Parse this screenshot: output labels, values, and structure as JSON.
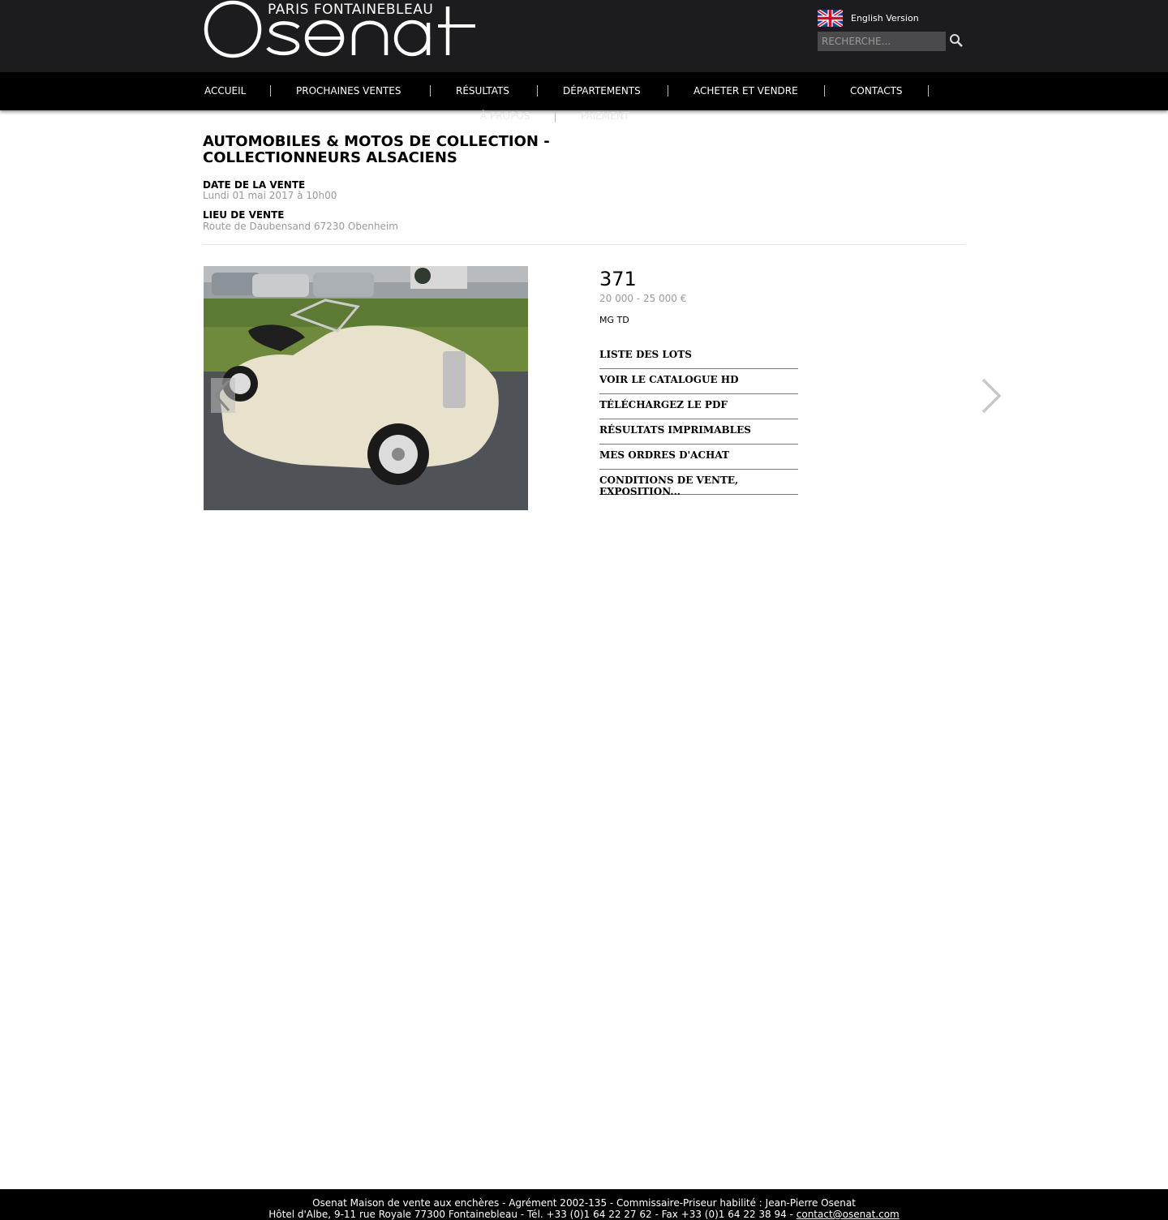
{
  "header": {
    "logo_tagline": "PARIS FONTAINEBLEAU",
    "logo_wordmark": "Osenat",
    "language_link": "English Version",
    "search_placeholder": "RECHERCHE...",
    "flag_icon": "uk-flag-icon",
    "search_icon": "magnifier-icon"
  },
  "nav": {
    "items": [
      "ACCUEIL",
      "PROCHAINES VENTES",
      "RÉSULTATS",
      "DÉPARTEMENTS",
      "ACHETER ET VENDRE",
      "CONTACTS"
    ],
    "row2": [
      "À PROPOS",
      "PAIEMENT"
    ]
  },
  "sale": {
    "title": "AUTOMOBILES & MOTOS DE COLLECTION - COLLECTIONNEURS ALSACIENS",
    "date_label": "DATE DE LA VENTE",
    "date_value": "Lundi 01 mai 2017 à 10h00",
    "place_label": "LIEU DE VENTE",
    "place_value": "Route de Daubensand 67230 Obenheim"
  },
  "lot": {
    "number": "371",
    "estimate": "20 000 - 25 000 €",
    "name": "MG TD"
  },
  "links": [
    "LISTE DES LOTS",
    "VOIR LE CATALOGUE HD",
    "TÉLÉCHARGEZ LE PDF",
    "RÉSULTATS IMPRIMABLES",
    "MES ORDRES D'ACHAT",
    "CONDITIONS DE VENTE, EXPOSITION..."
  ],
  "footer": {
    "line1": "Osenat Maison de vente aux enchères - Agrément 2002-135 - Commissaire-Priseur habilité : Jean-Pierre Osenat",
    "line2": "Hôtel d'Albe, 9-11 rue Royale 77300 Fontainebleau - Tél. +33 (0)1 64 22 27 62 - Fax +33 (0)1 64 22 38 94 -",
    "email": "contact@osenat.com"
  },
  "colors": {
    "header_bg": "#1c1c1e",
    "nav_bg": "#000000",
    "muted_text": "#999999"
  }
}
